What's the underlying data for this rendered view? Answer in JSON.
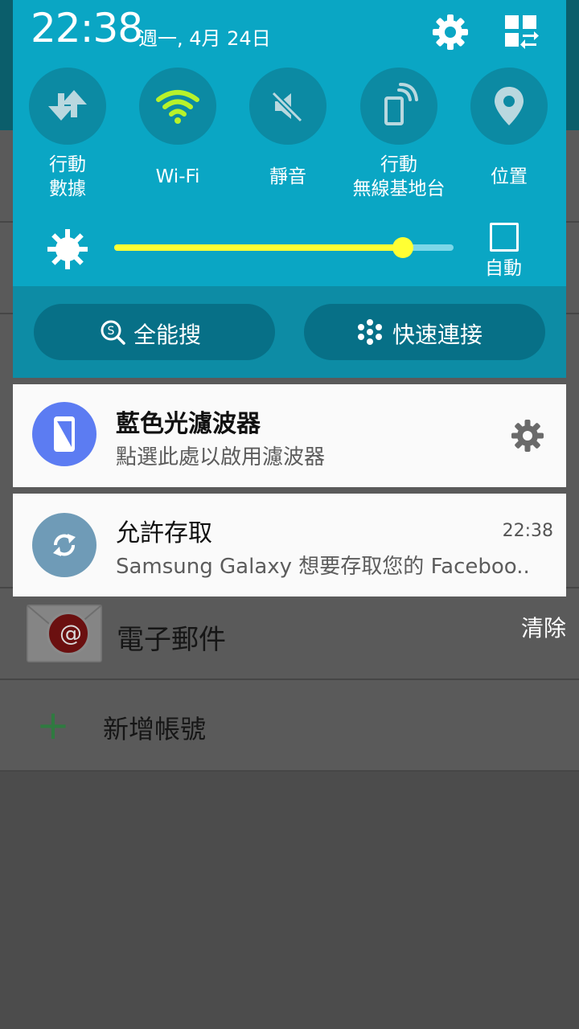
{
  "status": {
    "time": "22:38",
    "date": "週一, 4月 24日"
  },
  "quick_toggles": [
    {
      "label": "行動\n數據",
      "icon": "mobile-data-icon",
      "active": false
    },
    {
      "label": "Wi-Fi",
      "icon": "wifi-icon",
      "active": true
    },
    {
      "label": "靜音",
      "icon": "mute-icon",
      "active": false
    },
    {
      "label": "行動\n無線基地台",
      "icon": "hotspot-icon",
      "active": false
    },
    {
      "label": "位置",
      "icon": "location-icon",
      "active": false
    }
  ],
  "brightness": {
    "level": 0.85,
    "auto_label": "自動",
    "auto_checked": false
  },
  "actions": {
    "s_finder": "全能搜",
    "quick_connect": "快速連接"
  },
  "notifications": [
    {
      "title": "藍色光濾波器",
      "text": "點選此處以啟用濾波器",
      "icon": "blue-light-filter-icon",
      "icon_color": "#5c7cf2"
    },
    {
      "title": "允許存取",
      "time": "22:38",
      "text": "Samsung Galaxy 想要存取您的 Faceboo..",
      "icon": "sync-icon",
      "icon_color": "#6f9bb7"
    }
  ],
  "background_app": {
    "email_label": "電子郵件",
    "add_account_label": "新增帳號",
    "clear_label": "清除"
  },
  "colors": {
    "panel": "#0aa6c4",
    "slider_fill": "#ffff33",
    "wifi_active": "#b7f22b"
  }
}
